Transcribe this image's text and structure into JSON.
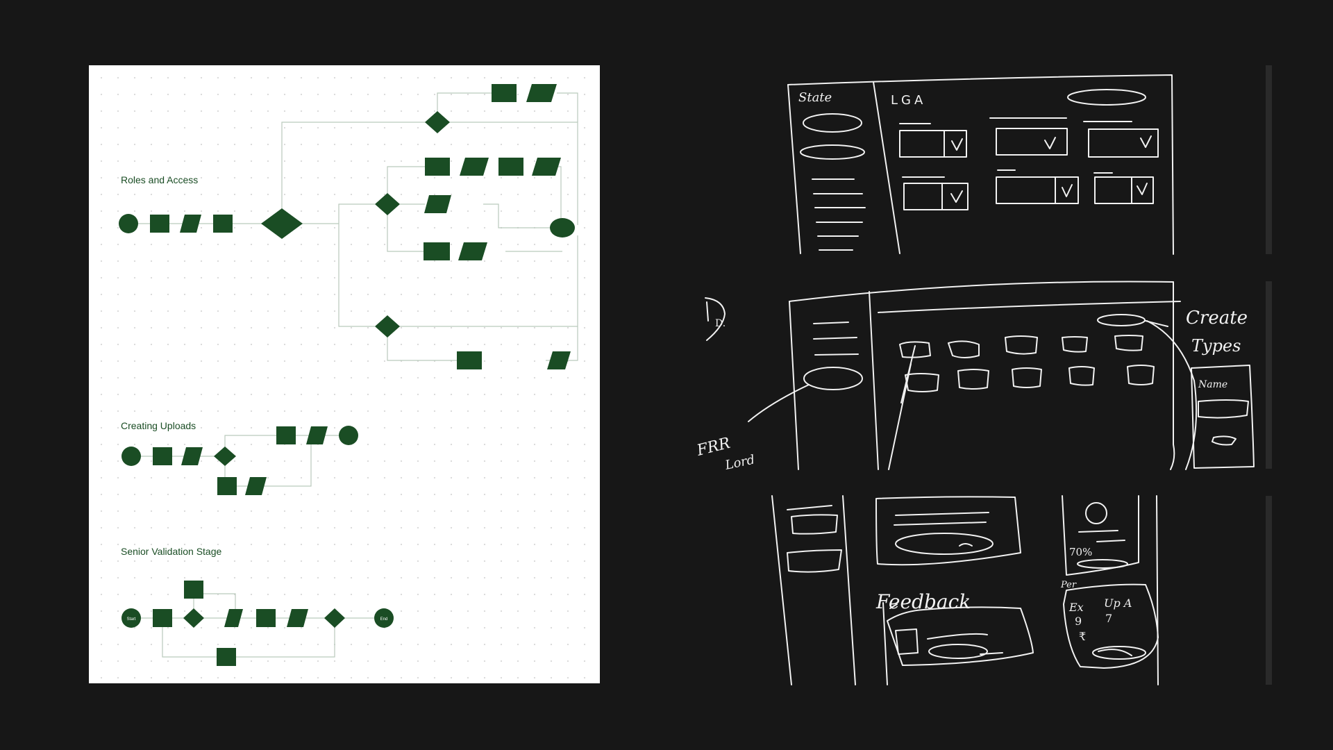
{
  "flowchart": {
    "sections": [
      {
        "key": "roles",
        "title": "Roles and Access"
      },
      {
        "key": "uploads",
        "title": "Creating Uploads"
      },
      {
        "key": "validation",
        "title": "Senior Validation Stage"
      }
    ],
    "validation_nodes": {
      "start": "Start",
      "end": "End"
    },
    "theme": {
      "node_fill": "#1a4d24",
      "connector": "#b9c9bc",
      "title_color": "#1a4d24",
      "canvas_bg": "#ffffff",
      "page_bg": "#171717"
    }
  },
  "sketches": {
    "panel1": {
      "sidebar_heading": "State",
      "main_heading": "LGA"
    },
    "panel2": {
      "annotation_left": "D.",
      "annotation_create": "Create",
      "annotation_types": "Types",
      "annotation_bottom": "FRR",
      "annotation_bottom_2": "Lord",
      "popup_label": "Name"
    },
    "panel3": {
      "feedback_label": "Feedback",
      "percent": "70%",
      "side_label": "Per",
      "ex_label": "Ex",
      "ex_value": "9",
      "up_label": "Up A",
      "up_value": "7",
      "rupee": "₹"
    },
    "ink_color": "#f2f2f2"
  }
}
